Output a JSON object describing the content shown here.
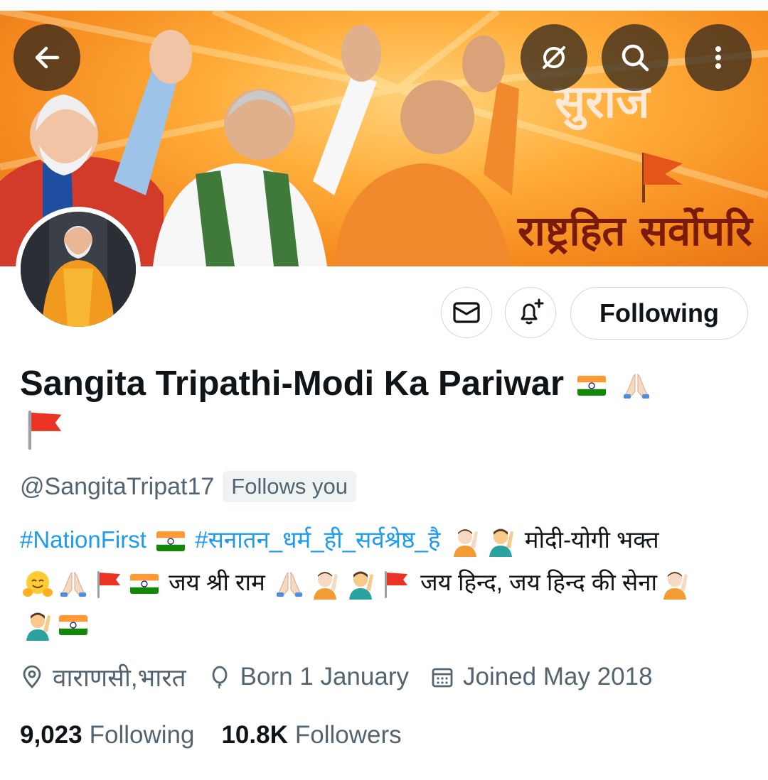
{
  "header": {
    "banner_text_top": "सुराज",
    "banner_text_bottom": "राष्ट्रहित सर्वोपरि"
  },
  "actions": {
    "following_label": "Following"
  },
  "profile": {
    "display_name": "Sangita Tripathi-Modi Ka Pariwar",
    "handle": "@SangitaTripat17",
    "follows_you_badge": "Follows you"
  },
  "bio": {
    "hashtag_1": "#NationFirst",
    "hashtag_2": "#सनातन_धर्म_ही_सर्वश्रेष्ठ_है",
    "text_1": "मोदी-योगी भक्त",
    "text_2": "जय श्री राम",
    "text_3": "जय हिन्द, जय हिन्द की सेना"
  },
  "meta": {
    "location": "वाराणसी,भारत",
    "birthday": "Born 1 January",
    "joined": "Joined May 2018"
  },
  "stats": {
    "following_count": "9,023",
    "following_label": "Following",
    "followers_count": "10.8K",
    "followers_label": "Followers"
  },
  "colors": {
    "accent": "#1d9bf0",
    "secondary_text": "#536471",
    "primary_text": "#0f1419",
    "banner_orange": "#f58a1f"
  },
  "icons": [
    "back-arrow-icon",
    "hide-icon",
    "search-icon",
    "more-vertical-icon",
    "mail-icon",
    "bell-plus-icon",
    "location-icon",
    "balloon-icon",
    "calendar-icon"
  ]
}
